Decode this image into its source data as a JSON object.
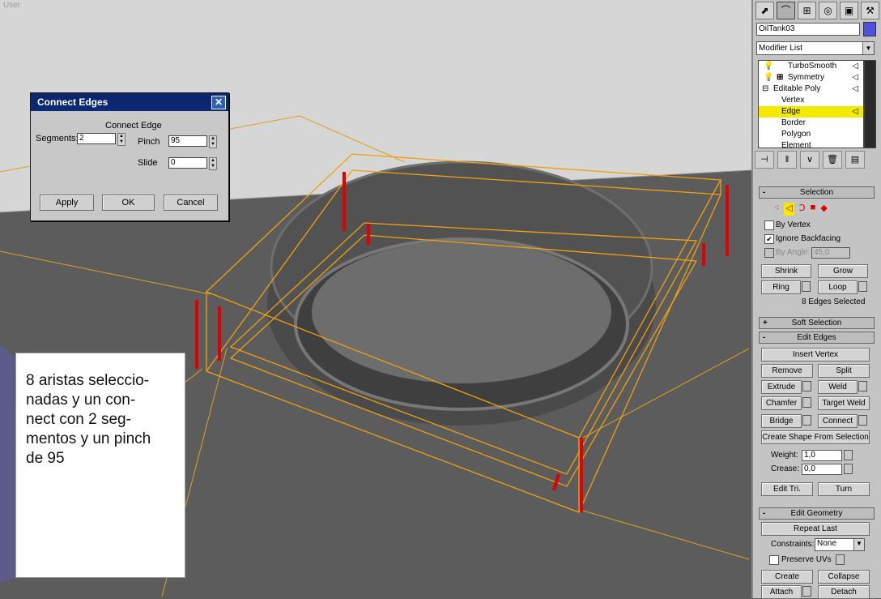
{
  "viewport": {
    "label": "User",
    "colors": {
      "floor": "#5a5a5a",
      "wall": "#d6d6d6",
      "wire": "#f0a010",
      "edge": "#e00000"
    }
  },
  "dialog": {
    "title": "Connect Edges",
    "group": "Connect Edge",
    "segments_label": "Segments:",
    "segments_value": "2",
    "pinch_label": "Pinch",
    "pinch_value": "95",
    "slide_label": "Slide",
    "slide_value": "0",
    "apply": "Apply",
    "ok": "OK",
    "cancel": "Cancel"
  },
  "note": {
    "text": "8 aristas seleccio-\nnadas y un con-\nnect con 2 seg-\nmentos y un pinch\nde 95"
  },
  "panel": {
    "tabs": [
      "create-icon",
      "modify-icon",
      "hierarchy-icon",
      "motion-icon",
      "display-icon",
      "utilities-icon"
    ],
    "object_name": "OilTank03",
    "object_color": "#5050e0",
    "modifier_list": "Modifier List",
    "stack": [
      {
        "label": "TurboSmooth"
      },
      {
        "label": "Symmetry"
      },
      {
        "label": "Editable Poly"
      },
      {
        "label": "Vertex"
      },
      {
        "label": "Edge"
      },
      {
        "label": "Border"
      },
      {
        "label": "Polygon"
      },
      {
        "label": "Element"
      }
    ],
    "selection": {
      "title": "Selection",
      "by_vertex": "By Vertex",
      "ignore_backfacing": "Ignore Backfacing",
      "by_angle": "By Angle:",
      "angle_value": "45,0",
      "shrink": "Shrink",
      "grow": "Grow",
      "ring": "Ring",
      "loop": "Loop",
      "status": "8 Edges Selected"
    },
    "soft_selection": {
      "title": "Soft Selection"
    },
    "edit_edges": {
      "title": "Edit Edges",
      "insert_vertex": "Insert Vertex",
      "remove": "Remove",
      "split": "Split",
      "extrude": "Extrude",
      "weld": "Weld",
      "chamfer": "Chamfer",
      "target_weld": "Target Weld",
      "bridge": "Bridge",
      "connect": "Connect",
      "create_shape": "Create Shape From Selection",
      "weight_label": "Weight:",
      "weight_value": "1,0",
      "crease_label": "Crease:",
      "crease_value": "0,0",
      "edit_tri": "Edit Tri.",
      "turn": "Turn"
    },
    "edit_geometry": {
      "title": "Edit Geometry",
      "repeat_last": "Repeat Last",
      "constraints_label": "Constraints:",
      "constraints_value": "None",
      "preserve_uvs": "Preserve UVs",
      "create": "Create",
      "collapse": "Collapse",
      "attach": "Attach",
      "detach": "Detach"
    }
  }
}
